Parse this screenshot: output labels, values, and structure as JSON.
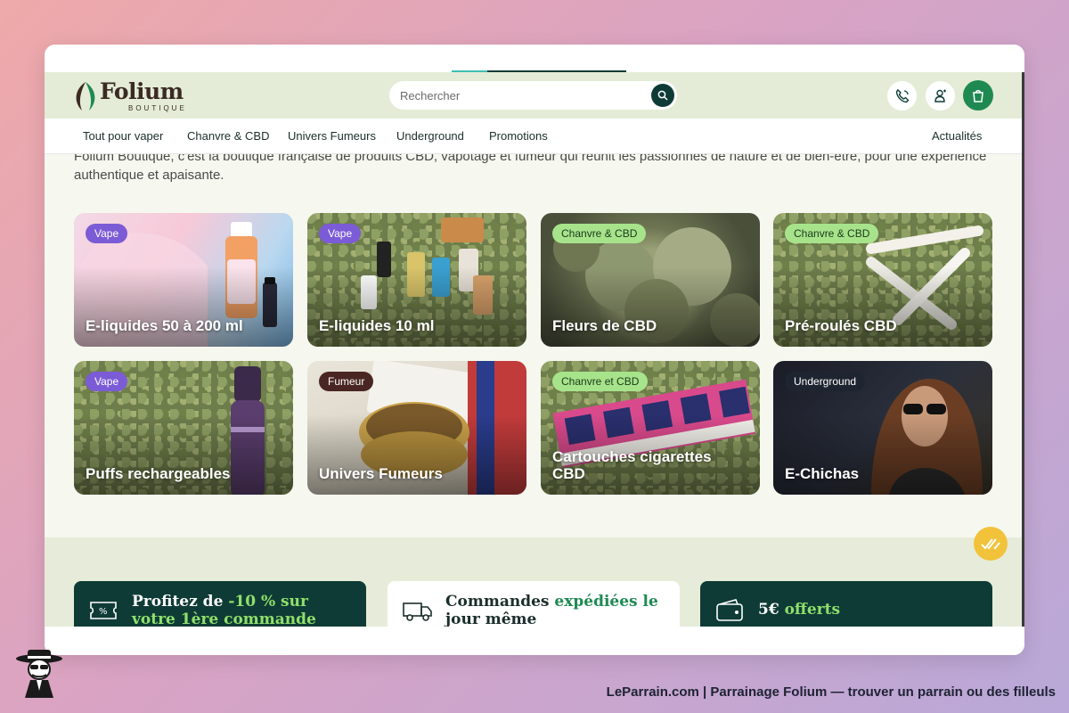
{
  "header": {
    "brand": "Folium",
    "brand_sub": "BOUTIQUE",
    "search_placeholder": "Rechercher"
  },
  "nav": {
    "items": [
      "Tout pour vaper",
      "Chanvre & CBD",
      "Univers Fumeurs",
      "Underground",
      "Promotions"
    ],
    "right": "Actualités"
  },
  "intro": "Folium Boutique, c'est la boutique française de produits CBD, vapotage et fumeur qui réunit les passionnés de nature et de bien-être, pour une expérience authentique et apaisante.",
  "categories": [
    {
      "badge": "Vape",
      "title": "E-liquides 50 à 200 ml"
    },
    {
      "badge": "Vape",
      "title": "E-liquides 10 ml"
    },
    {
      "badge": "Chanvre & CBD",
      "title": "Fleurs de CBD"
    },
    {
      "badge": "Chanvre & CBD",
      "title": "Pré-roulés CBD"
    },
    {
      "badge": "Vape",
      "title": "Puffs rechargeables"
    },
    {
      "badge": "Fumeur",
      "title": "Univers Fumeurs"
    },
    {
      "badge": "Chanvre et CBD",
      "title": "Cartouches cigarettes CBD"
    },
    {
      "badge": "Underground",
      "title": "E-Chichas"
    }
  ],
  "promos": [
    {
      "lead": "Profitez de ",
      "accent": "-10 % sur votre 1ère commande",
      "tail": ""
    },
    {
      "lead": "Commandes ",
      "accent": "expédiées le",
      "tail": " jour même"
    },
    {
      "lead": "5€ ",
      "accent": "offerts",
      "tail": ""
    }
  ],
  "credit": "LeParrain.com | Parrainage Folium — trouver un parrain ou des filleuls",
  "colors": {
    "brand_dark": "#0f3b36",
    "brand_green": "#1e8a52",
    "accent_green": "#8fe06b",
    "vape_badge": "#7c5bd6",
    "cbd_badge": "#a7e38b"
  }
}
